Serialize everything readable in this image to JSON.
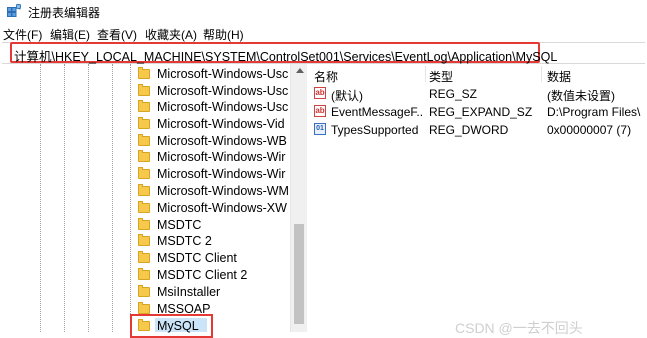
{
  "window": {
    "title": "注册表编辑器"
  },
  "menu": [
    "文件(F)",
    "编辑(E)",
    "查看(V)",
    "收藏夹(A)",
    "帮助(H)"
  ],
  "address": "计算机\\HKEY_LOCAL_MACHINE\\SYSTEM\\ControlSet001\\Services\\EventLog\\Application\\MySQL",
  "tree": {
    "items": [
      "Microsoft-Windows-Usc",
      "Microsoft-Windows-Usc",
      "Microsoft-Windows-Usc",
      "Microsoft-Windows-Vid",
      "Microsoft-Windows-WB",
      "Microsoft-Windows-Wir",
      "Microsoft-Windows-Wir",
      "Microsoft-Windows-WM",
      "Microsoft-Windows-XW",
      "MSDTC",
      "MSDTC 2",
      "MSDTC Client",
      "MSDTC Client 2",
      "MsiInstaller",
      "MSSOAP",
      "MySQL"
    ]
  },
  "list": {
    "headers": {
      "name": "名称",
      "type": "类型",
      "data": "数据"
    },
    "rows": [
      {
        "icon": "string-value-icon",
        "name": "(默认)",
        "type": "REG_SZ",
        "data": "(数值未设置)"
      },
      {
        "icon": "string-value-icon",
        "name": "EventMessageF...",
        "type": "REG_EXPAND_SZ",
        "data": "D:\\Program Files\\"
      },
      {
        "icon": "binary-value-icon",
        "name": "TypesSupported",
        "type": "REG_DWORD",
        "data": "0x00000007 (7)"
      }
    ]
  },
  "watermark": "CSDN @一去不回头",
  "colors": {
    "highlight": "#e53935",
    "folder": "#f6c94c",
    "selection": "#cce4f7"
  }
}
